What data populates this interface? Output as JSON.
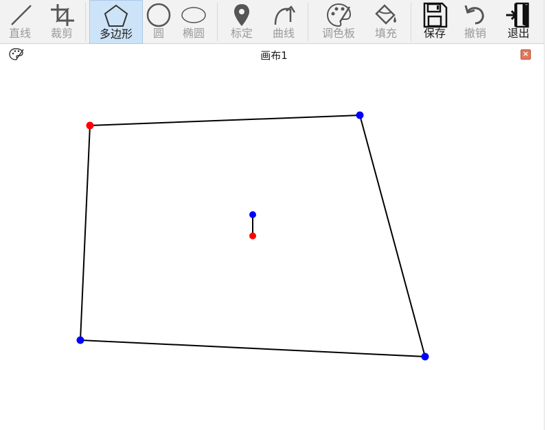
{
  "toolbar": {
    "tools": [
      {
        "id": "line",
        "label": "直线",
        "icon": "line-icon",
        "state": "disabled"
      },
      {
        "id": "crop",
        "label": "裁剪",
        "icon": "crop-icon",
        "state": "disabled"
      },
      {
        "id": "polygon",
        "label": "多边形",
        "icon": "pentagon-icon",
        "state": "active"
      },
      {
        "id": "circle",
        "label": "圆",
        "icon": "circle-icon",
        "state": "disabled"
      },
      {
        "id": "ellipse",
        "label": "椭圆",
        "icon": "ellipse-icon",
        "state": "disabled"
      },
      {
        "id": "mark",
        "label": "标定",
        "icon": "map-pin-icon",
        "state": "disabled"
      },
      {
        "id": "curve",
        "label": "曲线",
        "icon": "curved-arrow-icon",
        "state": "disabled"
      },
      {
        "id": "palette",
        "label": "调色板",
        "icon": "palette-icon",
        "state": "disabled"
      },
      {
        "id": "fill",
        "label": "填充",
        "icon": "paint-bucket-icon",
        "state": "disabled"
      },
      {
        "id": "save",
        "label": "保存",
        "icon": "floppy-disk-icon",
        "state": "enabled"
      },
      {
        "id": "undo",
        "label": "撤销",
        "icon": "undo-icon",
        "state": "disabled"
      },
      {
        "id": "exit",
        "label": "退出",
        "icon": "exit-door-icon",
        "state": "enabled"
      }
    ]
  },
  "canvas_tab": {
    "title": "画布1",
    "icon": "palette-icon",
    "close_icon": "close-icon",
    "close_glyph": "×"
  },
  "colors": {
    "active_vertex": "#ff0000",
    "vertex": "#0000ff",
    "edge": "#000000",
    "active_tool_bg": "#cde3f7",
    "close_button": "#e2775a"
  }
}
